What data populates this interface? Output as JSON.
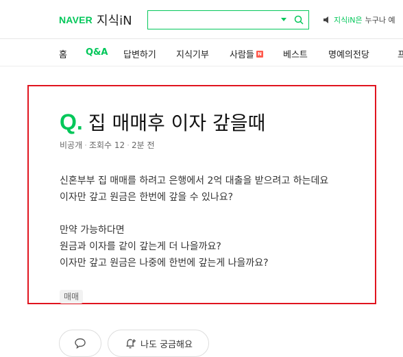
{
  "header": {
    "logo_naver": "NAVER",
    "logo_service": "지식iN",
    "search_value": "",
    "notice_highlight": "지식iN은",
    "notice_rest": "누구나 예"
  },
  "nav": {
    "items": [
      "홈",
      "Q&A",
      "답변하기",
      "지식기부",
      "사람들",
      "베스트",
      "명예의전당",
      "프"
    ],
    "active": "Q&A",
    "new_badge": "N"
  },
  "question": {
    "q_mark": "Q.",
    "title": "집 매매후 이자 갚을때",
    "author": "비공개",
    "views": "조회수 12",
    "time": "2분 전",
    "body_lines": [
      "신혼부부 집 매매를 하려고 은행에서 2억 대출을 받으려고 하는데요",
      "이자만 갚고 원금은 한번에 갚을 수 있나요?",
      "",
      "만약 가능하다면",
      "원금과 이자를 같이 갚는게 더 나을까요?",
      "이자만 갚고 원금은 나중에 한번에 갚는게 나을까요?"
    ],
    "tag": "매매"
  },
  "actions": {
    "curious_label": "나도 궁금해요"
  },
  "colors": {
    "brand": "#03c75a",
    "highlight_border": "#e0131e",
    "badge": "#ff5a4d"
  }
}
